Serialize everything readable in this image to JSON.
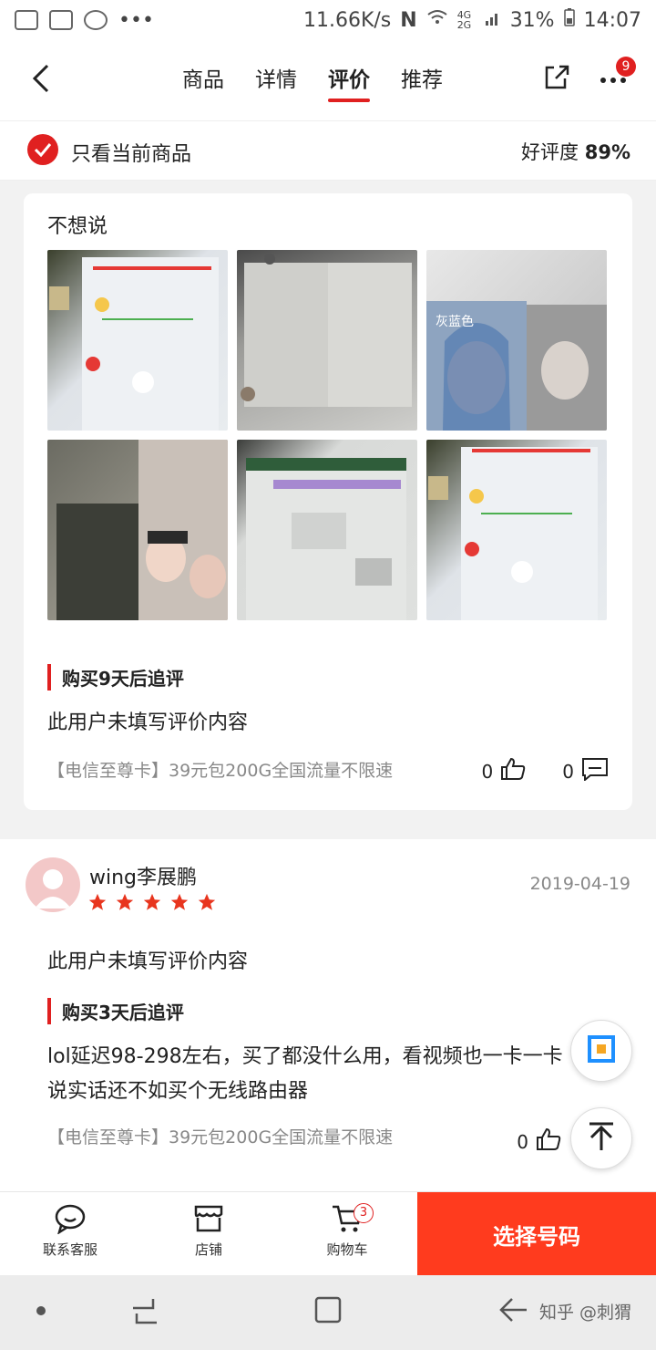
{
  "status_bar": {
    "speed": "11.66K/s",
    "network": "4G 2G",
    "battery": "31%",
    "time": "14:07"
  },
  "nav": {
    "tabs": [
      "商品",
      "详情",
      "评价",
      "推荐"
    ],
    "active_tab": "评价",
    "more_badge": "9"
  },
  "filter": {
    "label": "只看当前商品",
    "rating_label": "好评度",
    "rating_value": "89%"
  },
  "review1": {
    "text": "不想说",
    "image_captions": [
      "灰蓝色"
    ],
    "followup_label": "购买9天后追评",
    "followup_text": "此用户未填写评价内容",
    "product": "【电信至尊卡】39元包200G全国流量不限速",
    "likes": "0",
    "comments": "0"
  },
  "review2": {
    "username": "wing李展鹏",
    "stars": 5,
    "date": "2019-04-19",
    "text": "此用户未填写评价内容",
    "followup_label": "购买3天后追评",
    "followup_text": "lol延迟98-298左右，买了都没什么用，看视频也一卡一卡",
    "followup_text2": "说实话还不如买个无线路由器",
    "product": "【电信至尊卡】39元包200G全国流量不限速",
    "likes": "0"
  },
  "bottom_bar": {
    "service": "联系客服",
    "shop": "店铺",
    "cart": "购物车",
    "cart_badge": "3",
    "cta": "选择号码"
  },
  "watermark": "知乎 @刺猬",
  "colors": {
    "accent": "#e02020",
    "cta": "#ff3b1e"
  }
}
